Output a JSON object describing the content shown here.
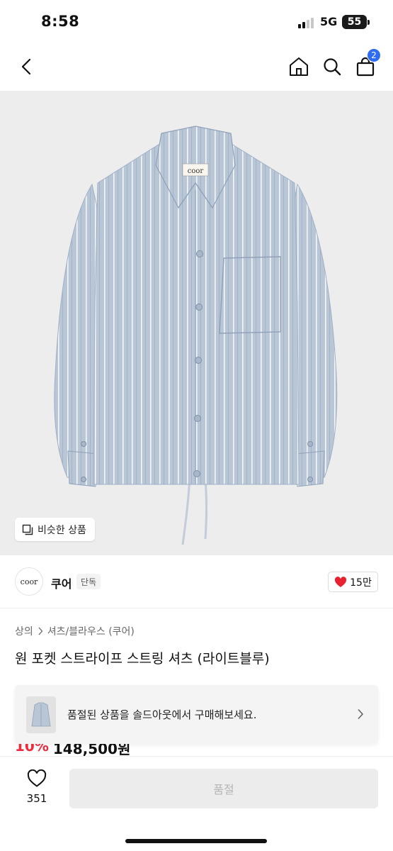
{
  "status": {
    "time": "8:58",
    "network": "5G",
    "battery": "55"
  },
  "nav": {
    "cart_count": "2"
  },
  "image": {
    "garment_label": "coor",
    "similar_button": "비슷한 상품"
  },
  "brand": {
    "logo_text": "coor",
    "name": "쿠어",
    "tag": "단독",
    "likes": "15만"
  },
  "breadcrumb": {
    "level1": "상의",
    "level2": "셔츠/블라우스 (쿠어)"
  },
  "product": {
    "title": "원 포켓 스트라이프 스트링 셔츠 (라이트블루)",
    "discount": "10%",
    "price": "148,500원"
  },
  "banner": {
    "text": "품절된 상품을 솔드아웃에서 구매해보세요."
  },
  "bottom": {
    "wish_count": "351",
    "soldout_label": "품절"
  },
  "colors": {
    "accent_blue": "#2f6cf6",
    "heart_red": "#e8202f",
    "shirt_blue": "#b9c6d6",
    "image_bg": "#ededed"
  }
}
